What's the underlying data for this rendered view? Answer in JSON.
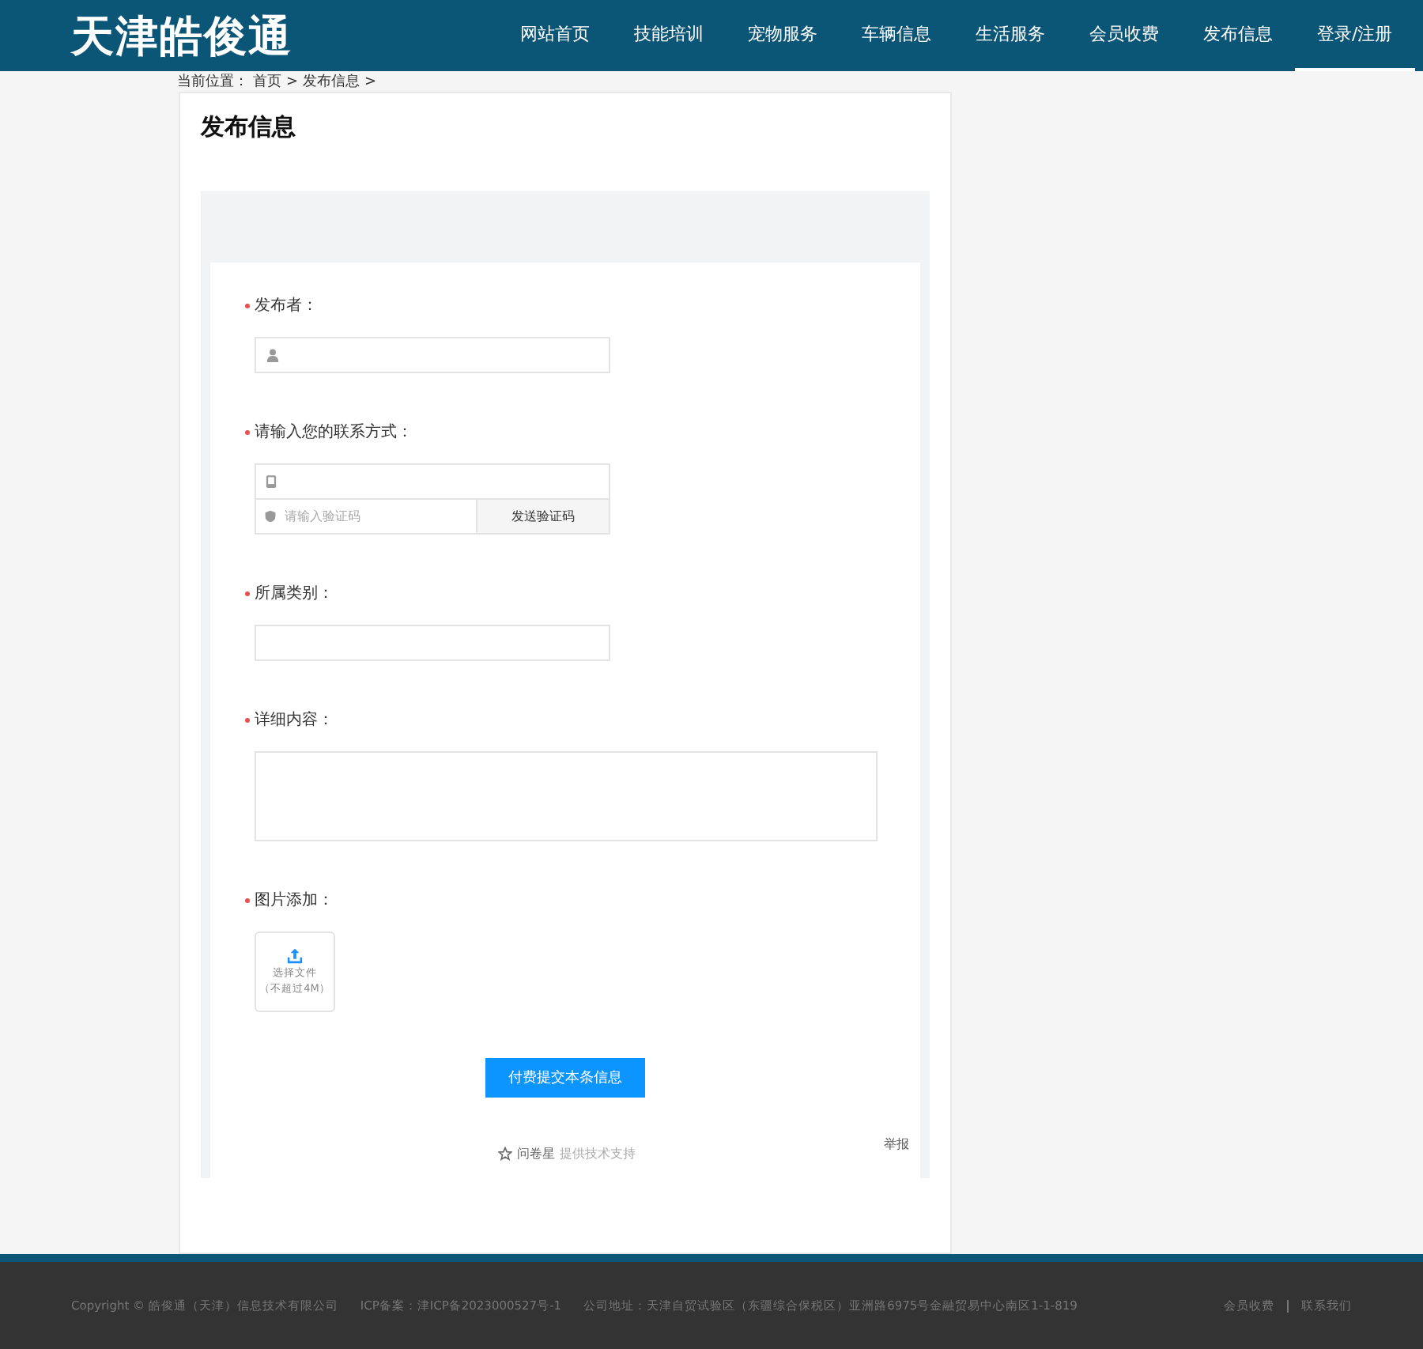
{
  "header": {
    "logo": "天津皓俊通",
    "nav": [
      {
        "label": "网站首页",
        "selected": false
      },
      {
        "label": "技能培训",
        "selected": false
      },
      {
        "label": "宠物服务",
        "selected": false
      },
      {
        "label": "车辆信息",
        "selected": false
      },
      {
        "label": "生活服务",
        "selected": false
      },
      {
        "label": "会员收费",
        "selected": false
      },
      {
        "label": "发布信息",
        "selected": false
      },
      {
        "label": "登录/注册",
        "selected": true
      }
    ]
  },
  "breadcrumb": [
    "当前位置：",
    "首页",
    ">",
    "发布信息",
    ">"
  ],
  "page_title": "发布信息",
  "form": {
    "fields": [
      {
        "kind": "text",
        "required": true,
        "label": "发布者："
      },
      {
        "kind": "phone",
        "required": true,
        "label": "请输入您的联系方式：",
        "code_placeholder": "请输入验证码",
        "code_button": "发送验证码"
      },
      {
        "kind": "select",
        "required": true,
        "label": "所属类别："
      },
      {
        "kind": "textarea",
        "required": true,
        "label": "详细内容："
      },
      {
        "kind": "upload",
        "required": true,
        "label": "图片添加：",
        "upload_text": "选择文件",
        "upload_hint": "（不超过4M）"
      }
    ],
    "submit": "付费提交本条信息",
    "brand": "问卷星",
    "support": "提供技术支持",
    "report": "举报"
  },
  "footer": {
    "copyright": "Copyright © 皓俊通（天津）信息技术有限公司",
    "icp": "ICP备案：津ICP备2023000527号-1",
    "address": "公司地址：天津自贸试验区（东疆综合保税区）亚洲路6975号金融贸易中心南区1-1-819",
    "links": [
      "会员收费",
      "联系我们"
    ]
  }
}
